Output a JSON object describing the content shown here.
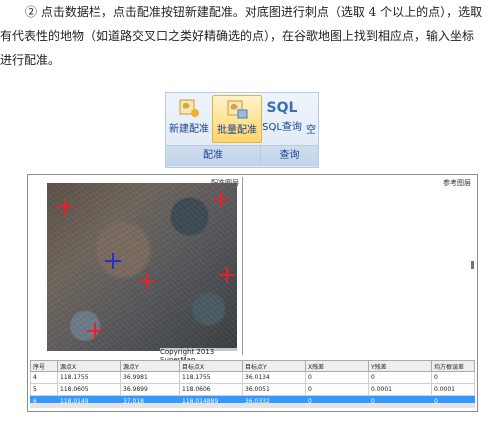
{
  "instructions": {
    "line1": "② 点击数据栏，点击配准按钮新建配准。对底图进行刺点（选取 4 个以上的点），选取",
    "line2": "有代表性的地物（如道路交叉口之类好精确选的点），在谷歌地图上找到相应点，输入坐标",
    "line3": "进行配准。"
  },
  "ribbon": {
    "buttons": {
      "new_align": "新建配准",
      "batch_align": "批量配准",
      "sql_query": "SQL查询",
      "more": "空"
    },
    "sql_icon_text": "SQL",
    "groups": {
      "align": "配准",
      "query": "查询"
    }
  },
  "panes": {
    "left_title": "配准图层",
    "right_title": "参考图层",
    "copyright": "Copyright 2013 SuperMap"
  },
  "table": {
    "headers": [
      "序号",
      "源点X",
      "源点Y",
      "目标点X",
      "目标点Y",
      "X残差",
      "Y残差",
      "均方根误差"
    ],
    "rows": [
      [
        "4",
        "118.1755",
        "36.9981",
        "118.1755",
        "36.0134",
        "0",
        "0",
        "0"
      ],
      [
        "5",
        "118.0605",
        "36.9899",
        "118.0606",
        "36.0051",
        "0",
        "0.0001",
        "0.0001"
      ],
      [
        "6",
        "118.0149",
        "37.018",
        "118.014889",
        "36.0332",
        "0",
        "0",
        "0"
      ]
    ],
    "selected_row": 2
  },
  "colors": {
    "marker_red": "#e8202a",
    "marker_blue": "#2233cc",
    "selection": "#3399ff"
  }
}
